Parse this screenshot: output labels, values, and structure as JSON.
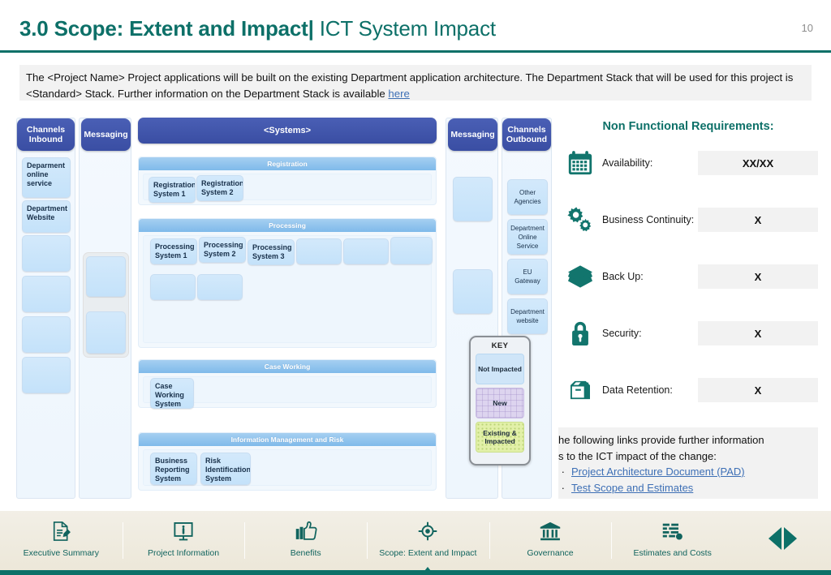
{
  "header": {
    "title_strong": "3.0 Scope: Extent and Impact",
    "title_pipe": "|",
    "title_light": "ICT System Impact",
    "page_number": "10"
  },
  "intro": {
    "text_before": "The <Project Name> Project applications will be built on the existing Department application architecture. The Department Stack that will be used for this project is <Standard> Stack. Further information on the Department Stack is available ",
    "link_label": "here"
  },
  "diagram": {
    "columns": {
      "channels_inbound": {
        "title": "Channels Inbound",
        "nodes": [
          "Deparment online service",
          "Department Website",
          "",
          "",
          "",
          ""
        ]
      },
      "messaging_in": {
        "title": "Messaging",
        "nodes": [
          "",
          ""
        ]
      },
      "messaging_out": {
        "title": "Messaging",
        "nodes": [
          "",
          ""
        ]
      },
      "channels_outbound": {
        "title": "Channels Outbound",
        "nodes": [
          "Other Agencies",
          "Department Online Service",
          "EU Gateway",
          "Department website"
        ]
      }
    },
    "systems": {
      "title": "<Systems>",
      "groups": [
        {
          "title": "Registration",
          "nodes": [
            "Registration System 1",
            "Registration System 2"
          ]
        },
        {
          "title": "Processing",
          "nodes": [
            "Processing System 1",
            "Processing System 2",
            "Processing System 3",
            "",
            "",
            "",
            "",
            ""
          ]
        },
        {
          "title": "Case Working",
          "nodes": [
            "Case Working System"
          ]
        },
        {
          "title": "Information Management and Risk",
          "nodes": [
            "Business Reporting System",
            "Risk Identification System"
          ]
        }
      ]
    },
    "key": {
      "title": "KEY",
      "items": [
        {
          "label": "Not Impacted",
          "color": "#cfe5f8"
        },
        {
          "label": "New",
          "color": "#ddd4ef"
        },
        {
          "label": "Existing & Impacted",
          "color": "#e2f0a8"
        }
      ]
    }
  },
  "nfr": {
    "title": "Non Functional Requirements:",
    "rows": [
      {
        "icon": "calendar-icon",
        "label": "Availability:",
        "value": "XX/XX"
      },
      {
        "icon": "gears-icon",
        "label": "Business Continuity:",
        "value": "X"
      },
      {
        "icon": "layers-icon",
        "label": "Back Up:",
        "value": "X"
      },
      {
        "icon": "lock-icon",
        "label": "Security:",
        "value": "X"
      },
      {
        "icon": "archive-box-icon",
        "label": "Data Retention:",
        "value": "X"
      }
    ]
  },
  "links_panel": {
    "line1": "he following links provide further information",
    "line2": "s to the ICT impact of the change:",
    "items": [
      "Project Architecture Document (PAD)",
      "Test Scope and Estimates"
    ]
  },
  "nav": {
    "items": [
      {
        "icon": "document-edit-icon",
        "label": "Executive Summary",
        "active": false
      },
      {
        "icon": "monitor-info-icon",
        "label": "Project Information",
        "active": false
      },
      {
        "icon": "thumbs-up-icon",
        "label": "Benefits",
        "active": false
      },
      {
        "icon": "target-icon",
        "label": "Scope: Extent and Impact",
        "active": true
      },
      {
        "icon": "bank-icon",
        "label": "Governance",
        "active": false
      },
      {
        "icon": "bar-chart-icon",
        "label": "Estimates and Costs",
        "active": false
      }
    ],
    "prev": "previous-slide",
    "next": "next-slide"
  },
  "colors": {
    "brand_teal": "#0d7068",
    "header_blue": "#3a4ea3",
    "node_blue": "#c4e2fa",
    "link_blue": "#3d6fb5"
  }
}
